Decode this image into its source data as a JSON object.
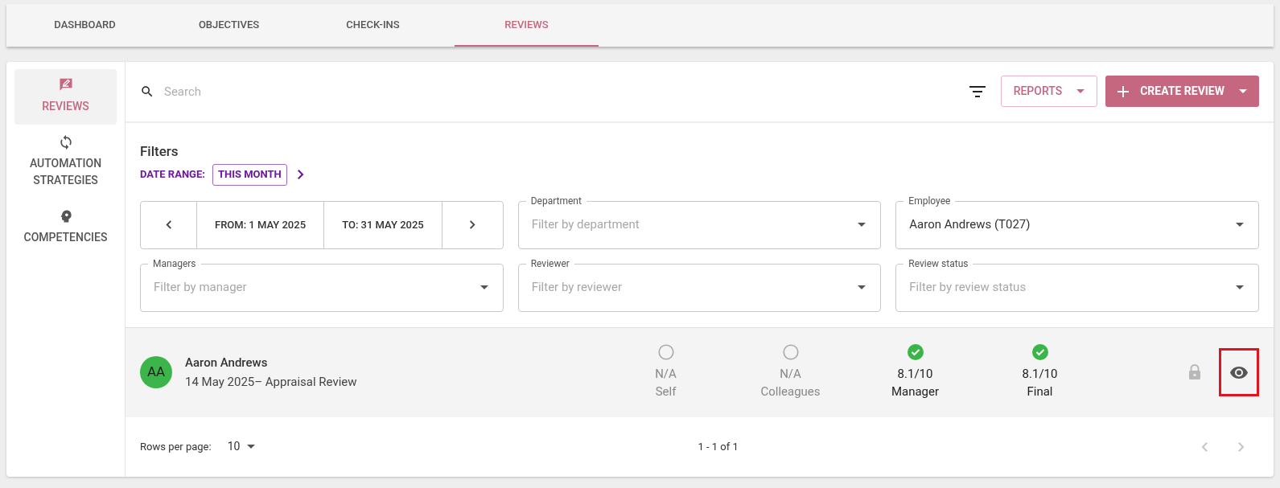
{
  "tabs": [
    {
      "label": "DASHBOARD",
      "selected": false
    },
    {
      "label": "OBJECTIVES",
      "selected": false
    },
    {
      "label": "CHECK-INS",
      "selected": false
    },
    {
      "label": "REVIEWS",
      "selected": true
    }
  ],
  "sidebar": {
    "items": [
      {
        "label": "REVIEWS",
        "kind": "reviews",
        "selected": true
      },
      {
        "label": "AUTOMATION STRATEGIES",
        "kind": "automation",
        "selected": false
      },
      {
        "label": "COMPETENCIES",
        "kind": "competencies",
        "selected": false
      }
    ]
  },
  "search": {
    "placeholder": "Search"
  },
  "buttons": {
    "reports": "REPORTS",
    "create": "CREATE REVIEW"
  },
  "filters": {
    "title": "Filters",
    "date_range_label": "DATE RANGE:",
    "date_range_value": "THIS MONTH",
    "from": "FROM: 1 MAY 2025",
    "to": "TO: 31 MAY 2025",
    "fields": [
      {
        "label": "Department",
        "placeholder": "Filter by department"
      },
      {
        "label": "Employee",
        "value": "Aaron Andrews (T027)"
      },
      {
        "label": "Managers",
        "placeholder": "Filter by manager"
      },
      {
        "label": "Reviewer",
        "placeholder": "Filter by reviewer"
      },
      {
        "label": "Review status",
        "placeholder": "Filter by review status"
      }
    ]
  },
  "reviews": [
    {
      "initials": "AA",
      "name": "Aaron Andrews",
      "subtitle": "14 May 2025– Appraisal Review",
      "locked": true,
      "view_highlighted": true,
      "scores": [
        {
          "value": "N/A",
          "label": "Self",
          "done": false
        },
        {
          "value": "N/A",
          "label": "Colleagues",
          "done": false
        },
        {
          "value": "8.1/10",
          "label": "Manager",
          "done": true
        },
        {
          "value": "8.1/10",
          "label": "Final",
          "done": true
        }
      ]
    }
  ],
  "pagination": {
    "rows_per_page_label": "Rows per page:",
    "rows_per_page": "10",
    "range": "1 - 1 of 1"
  }
}
